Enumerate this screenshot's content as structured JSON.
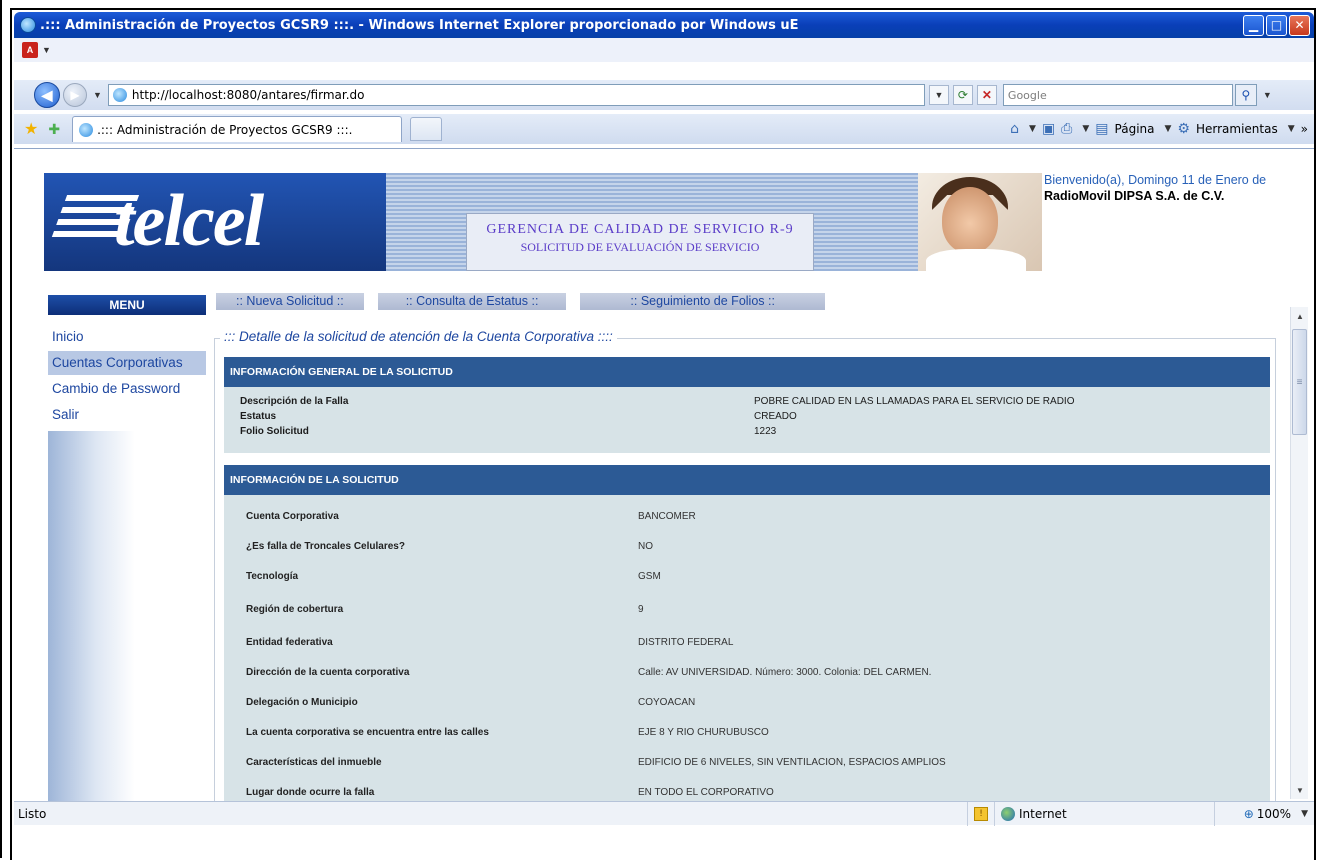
{
  "window": {
    "title": ".::: Administración de Proyectos GCSR9 :::. - Windows Internet Explorer proporcionado por Windows uE",
    "minimize": "▁",
    "maximize": "□",
    "close": "✕"
  },
  "address": {
    "url": "http://localhost:8080/antares/firmar.do",
    "search_placeholder": "Google"
  },
  "tab": {
    "title": ".::: Administración de Proyectos GCSR9 :::."
  },
  "commands": {
    "page": "Página",
    "tools": "Herramientas"
  },
  "banner": {
    "logo": "telcel",
    "heading_1": "GERENCIA DE CALIDAD DE SERVICIO R-9",
    "heading_2": "SOLICITUD DE EVALUACIÓN DE SERVICIO",
    "welcome": "Bienvenido(a), Domingo 11 de Enero de",
    "company": "RadioMovil DIPSA S.A. de C.V."
  },
  "menu": {
    "title": "MENU",
    "items": [
      {
        "label": "Inicio"
      },
      {
        "label": "Cuentas Corporativas"
      },
      {
        "label": "Cambio de Password"
      },
      {
        "label": "Salir"
      }
    ]
  },
  "top_links": [
    {
      "label": ":: Nueva Solicitud ::"
    },
    {
      "label": ":: Consulta de Estatus ::"
    },
    {
      "label": ":: Seguimiento de Folios ::"
    }
  ],
  "detail": {
    "legend": "::: Detalle de la solicitud de atención de la Cuenta Corporativa ::::",
    "general": {
      "title": "INFORMACIÓN GENERAL DE LA SOLICITUD",
      "rows": [
        {
          "k": "Descripción de la Falla",
          "v": "POBRE CALIDAD EN LAS LLAMADAS PARA EL SERVICIO DE RADIO"
        },
        {
          "k": "Estatus",
          "v": "CREADO"
        },
        {
          "k": "Folio Solicitud",
          "v": "1223"
        }
      ]
    },
    "info": {
      "title": "INFORMACIÓN DE LA SOLICITUD",
      "rows": [
        {
          "k": "Cuenta Corporativa",
          "v": "BANCOMER"
        },
        {
          "k": "¿Es falla de Troncales Celulares?",
          "v": "NO"
        },
        {
          "k": "Tecnología",
          "v": "GSM"
        },
        {
          "k": "Región de cobertura",
          "v": "9"
        },
        {
          "k": "Entidad federativa",
          "v": "DISTRITO FEDERAL"
        },
        {
          "k": "Dirección de la cuenta corporativa",
          "v": "Calle: AV UNIVERSIDAD. Número: 3000. Colonia: DEL CARMEN."
        },
        {
          "k": "Delegación o Municipio",
          "v": "COYOACAN"
        },
        {
          "k": "La cuenta corporativa se encuentra entre las calles",
          "v": "EJE 8 Y RIO CHURUBUSCO"
        },
        {
          "k": "Características del inmueble",
          "v": "EDIFICIO DE 6 NIVELES, SIN VENTILACION, ESPACIOS AMPLIOS"
        },
        {
          "k": "Lugar donde ocurre la falla",
          "v": "EN TODO EL CORPORATIVO"
        }
      ]
    }
  },
  "status": {
    "text": "Listo",
    "zone": "Internet",
    "zoom": "100%"
  }
}
